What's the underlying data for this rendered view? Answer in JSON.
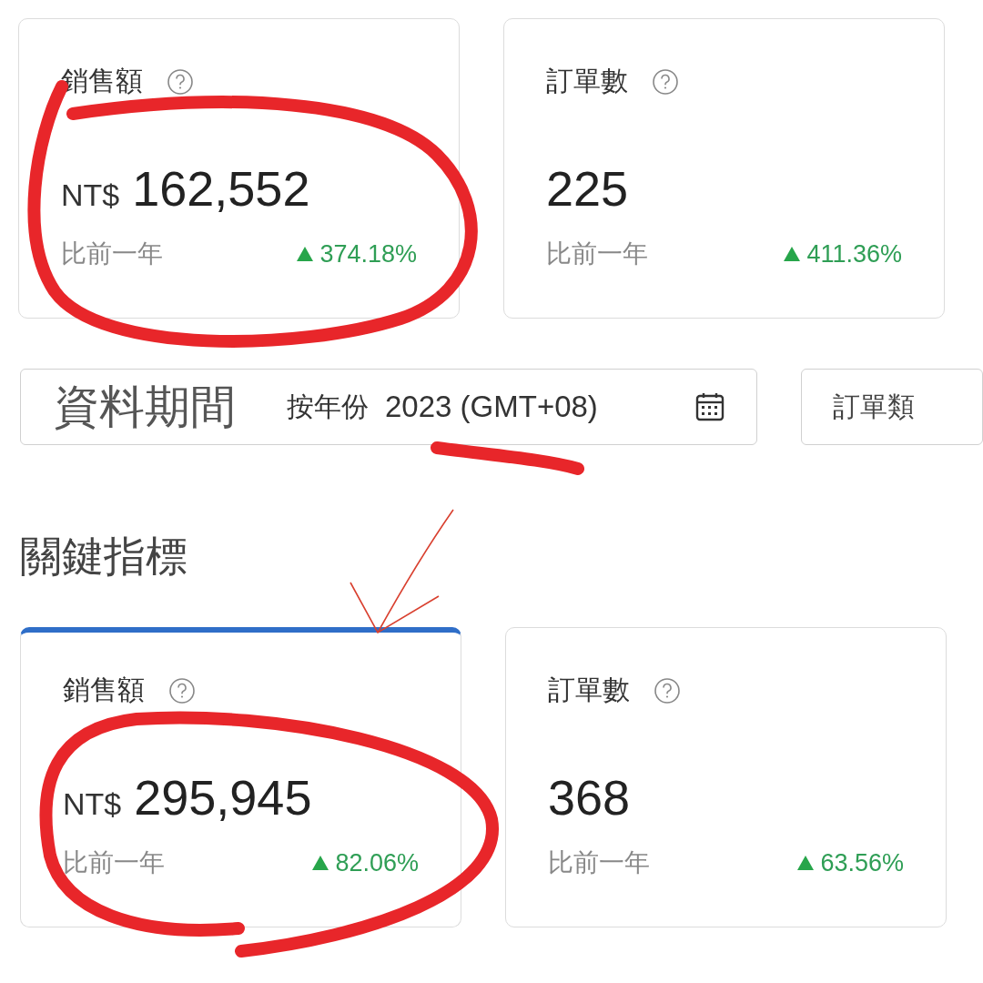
{
  "top_cards": [
    {
      "title": "銷售額",
      "prefix": "NT$",
      "value": "162,552",
      "compare_label": "比前一年",
      "change": "374.18%",
      "kind": "up",
      "selected": false
    },
    {
      "title": "訂單數",
      "value": "225",
      "compare_label": "比前一年",
      "change": "411.36%",
      "kind": "up",
      "selected": false
    }
  ],
  "filter_bar": {
    "label": "資料期間",
    "period_type": "按年份",
    "period": "2023 (GMT+08)"
  },
  "next_filter": {
    "label": "訂單類"
  },
  "section_title": "關鍵指標",
  "key_metrics": [
    {
      "title": "銷售額",
      "prefix": "NT$",
      "value": "295,945",
      "compare_label": "比前一年",
      "change": "82.06%",
      "kind": "up",
      "selected": true
    },
    {
      "title": "訂單數",
      "value": "368",
      "compare_label": "比前一年",
      "change": "63.56%",
      "kind": "up",
      "selected": false
    }
  ]
}
